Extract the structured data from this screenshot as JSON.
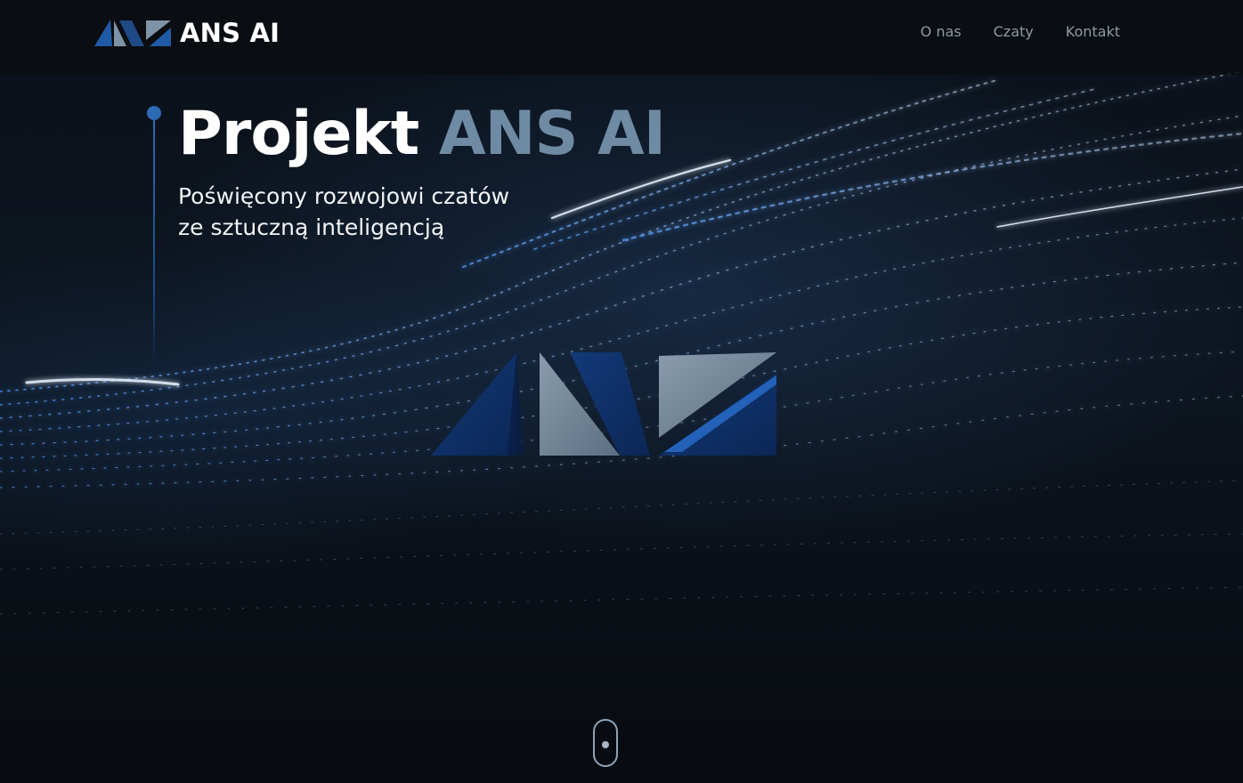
{
  "brand": {
    "name": "ANS AI",
    "logo_icon": "ans-logo-icon"
  },
  "nav": {
    "items": [
      {
        "label": "O nas"
      },
      {
        "label": "Czaty"
      },
      {
        "label": "Kontakt"
      }
    ]
  },
  "hero": {
    "title_part1": "Projekt",
    "title_part2": "ANS AI",
    "subtitle_line1": "Poświęcony rozwojowi czatów",
    "subtitle_line2": "ze sztuczną inteligencją",
    "center_logo_icon": "ans-logo-icon",
    "scroll_icon": "scroll-mouse-icon"
  },
  "colors": {
    "accent_blue": "#2c6ab4",
    "title_muted": "#6f8aa3",
    "background": "#0a0e15"
  }
}
